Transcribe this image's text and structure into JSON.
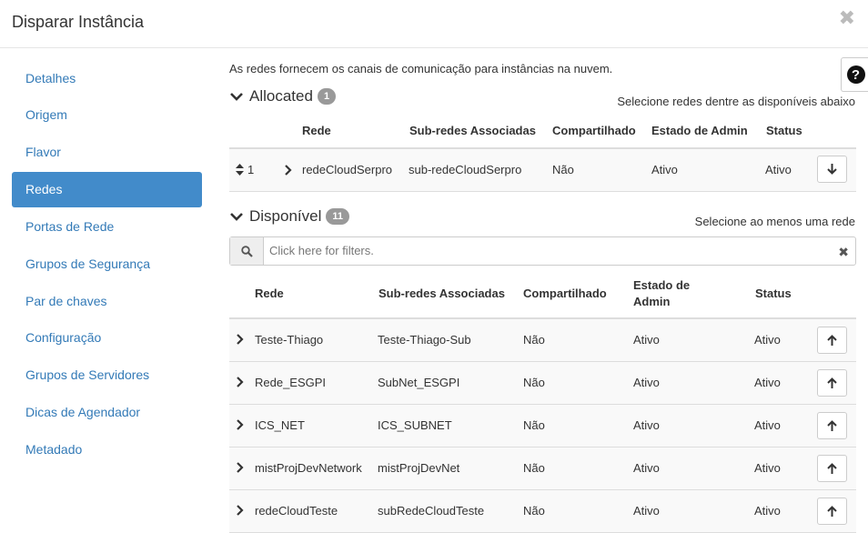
{
  "modal": {
    "title": "Disparar Instância",
    "close_glyph": "✖"
  },
  "sidebar": {
    "items": [
      {
        "label": "Detalhes"
      },
      {
        "label": "Origem"
      },
      {
        "label": "Flavor"
      },
      {
        "label": "Redes",
        "active": true
      },
      {
        "label": "Portas de Rede"
      },
      {
        "label": "Grupos de Segurança"
      },
      {
        "label": "Par de chaves"
      },
      {
        "label": "Configuração"
      },
      {
        "label": "Grupos de Servidores"
      },
      {
        "label": "Dicas de Agendador"
      },
      {
        "label": "Metadado"
      }
    ]
  },
  "help": {
    "glyph": "?"
  },
  "description": "As redes fornecem os canais de comunicação para instâncias na nuvem.",
  "allocated": {
    "title": "Allocated",
    "count": "1",
    "hint": "Selecione redes dentre as disponíveis abaixo",
    "columns": {
      "rede": "Rede",
      "subredes": "Sub-redes Associadas",
      "compartilhado": "Compartilhado",
      "estado": "Estado de Admin",
      "status": "Status"
    },
    "rows": [
      {
        "order": "1",
        "rede": "redeCloudSerpro",
        "subredes": "sub-redeCloudSerpro",
        "compartilhado": "Não",
        "estado": "Ativo",
        "status": "Ativo"
      }
    ]
  },
  "available": {
    "title": "Disponível",
    "count": "11",
    "hint": "Selecione ao menos uma rede",
    "filter_placeholder": "Click here for filters.",
    "columns": {
      "rede": "Rede",
      "subredes": "Sub-redes Associadas",
      "compartilhado": "Compartilhado",
      "estado_1": "Estado de",
      "estado_2": "Admin",
      "status": "Status"
    },
    "rows": [
      {
        "rede": "Teste-Thiago",
        "subredes": "Teste-Thiago-Sub",
        "compartilhado": "Não",
        "estado": "Ativo",
        "status": "Ativo"
      },
      {
        "rede": "Rede_ESGPI",
        "subredes": "SubNet_ESGPI",
        "compartilhado": "Não",
        "estado": "Ativo",
        "status": "Ativo"
      },
      {
        "rede": "ICS_NET",
        "subredes": "ICS_SUBNET",
        "compartilhado": "Não",
        "estado": "Ativo",
        "status": "Ativo"
      },
      {
        "rede": "mistProjDevNetwork",
        "subredes": "mistProjDevNet",
        "compartilhado": "Não",
        "estado": "Ativo",
        "status": "Ativo"
      },
      {
        "rede": "redeCloudTeste",
        "subredes": "subRedeCloudTeste",
        "compartilhado": "Não",
        "estado": "Ativo",
        "status": "Ativo"
      }
    ]
  }
}
